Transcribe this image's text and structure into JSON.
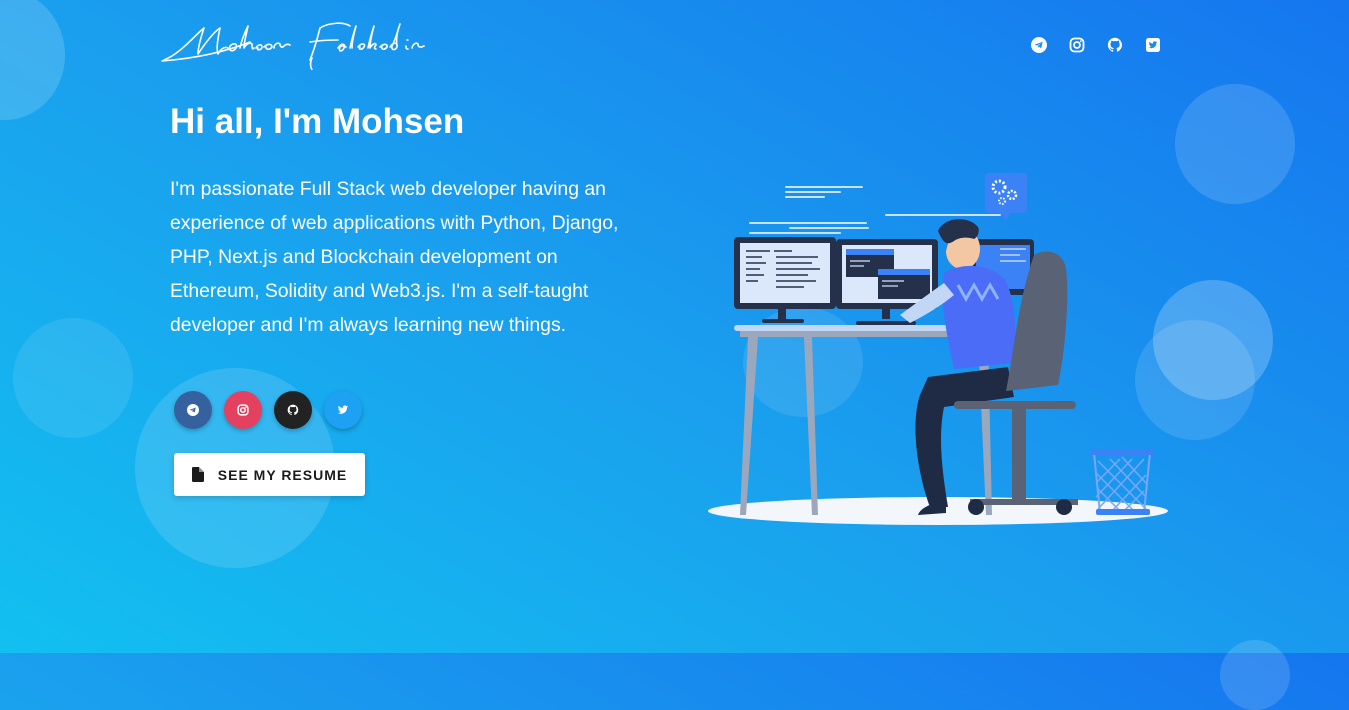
{
  "header": {
    "logo_text": "Mohsen Falakedin",
    "social_icons": [
      "telegram-icon",
      "instagram-icon",
      "github-icon",
      "twitter-icon"
    ]
  },
  "hero": {
    "greeting": "Hi all, I'm Mohsen",
    "description": "I'm passionate Full Stack web developer having an experience of web applications with Python, Django, PHP, Next.js and Blockchain development on Ethereum, Solidity and Web3.js. I'm a self-taught developer and I'm always learning new things.",
    "social_buttons": [
      {
        "icon": "telegram-icon",
        "color": "#35619f"
      },
      {
        "icon": "instagram-icon",
        "color": "#e4405f"
      },
      {
        "icon": "github-icon",
        "color": "#222222"
      },
      {
        "icon": "twitter-icon",
        "color": "#1da1f2"
      }
    ],
    "resume_button": "SEE MY RESUME"
  },
  "colors": {
    "gradient_start": "#12c0f0",
    "gradient_end": "#1576ef"
  }
}
